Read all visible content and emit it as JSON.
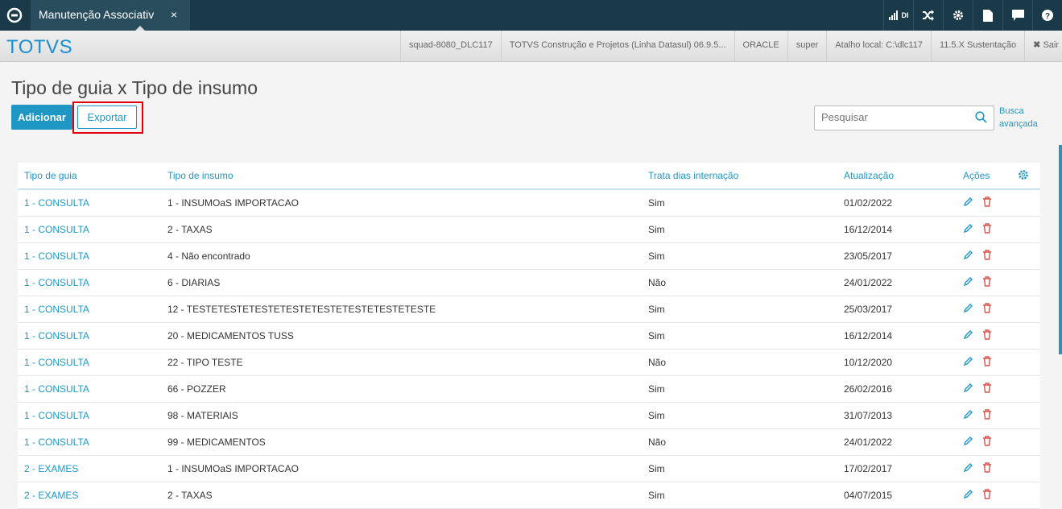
{
  "topbar": {
    "tab_label": "Manutenção Associativ",
    "tab_close": "×",
    "icons": [
      "signal-icon",
      "shuffle-icon",
      "gear-icon",
      "document-icon",
      "chat-icon",
      "help-icon"
    ],
    "signal_text": "DI"
  },
  "brandbar": {
    "brand": "TOTVS",
    "items": [
      "squad-8080_DLC117",
      "TOTVS Construção e Projetos (Linha Datasul) 06.9.5...",
      "ORACLE",
      "super",
      "Atalho local: C:\\dlc117",
      "11.5.X Sustentação"
    ],
    "exit_label": "Sair"
  },
  "page": {
    "title": "Tipo de guia x Tipo de insumo",
    "add_label": "Adicionar",
    "export_label": "Exportar",
    "search_placeholder": "Pesquisar",
    "advanced_search": "Busca avançada"
  },
  "table": {
    "headers": [
      "Tipo de guia",
      "Tipo de insumo",
      "Trata dias internação",
      "Atualização",
      "Ações"
    ],
    "rows": [
      [
        "1 - CONSULTA",
        "1 - INSUMOaS IMPORTACAO",
        "Sim",
        "01/02/2022"
      ],
      [
        "1 - CONSULTA",
        "2 - TAXAS",
        "Sim",
        "16/12/2014"
      ],
      [
        "1 - CONSULTA",
        "4 - Não encontrado",
        "Sim",
        "23/05/2017"
      ],
      [
        "1 - CONSULTA",
        "6 - DIARIAS",
        "Não",
        "24/01/2022"
      ],
      [
        "1 - CONSULTA",
        "12 - TESTETESTETESTETESTETESTETESTETESTETESTE",
        "Sim",
        "25/03/2017"
      ],
      [
        "1 - CONSULTA",
        "20 - MEDICAMENTOS TUSS",
        "Sim",
        "16/12/2014"
      ],
      [
        "1 - CONSULTA",
        "22 - TIPO TESTE",
        "Não",
        "10/12/2020"
      ],
      [
        "1 - CONSULTA",
        "66 - POZZER",
        "Sim",
        "26/02/2016"
      ],
      [
        "1 - CONSULTA",
        "98 - MATERIAIS",
        "Sim",
        "31/07/2013"
      ],
      [
        "1 - CONSULTA",
        "99 - MEDICAMENTOS",
        "Não",
        "24/01/2022"
      ],
      [
        "2 - EXAMES",
        "1 - INSUMOaS IMPORTACAO",
        "Sim",
        "17/02/2017"
      ],
      [
        "2 - EXAMES",
        "2 - TAXAS",
        "Sim",
        "04/07/2015"
      ]
    ]
  },
  "colors": {
    "accent": "#1f97c4",
    "topbar": "#1a3a4a",
    "highlight": "#e0000a",
    "delete": "#d9534f"
  }
}
